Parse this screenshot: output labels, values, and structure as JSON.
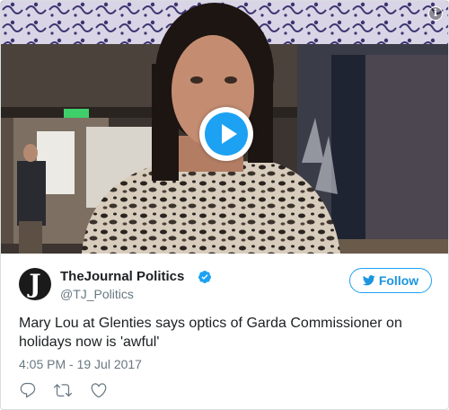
{
  "tweet": {
    "media": {
      "type": "video",
      "play_icon": "play-icon",
      "info_icon": "info-icon",
      "info_glyph": "i"
    },
    "author": {
      "avatar_letter": "J",
      "display_name": "TheJournal Politics",
      "handle": "@TJ_Politics",
      "verified": true
    },
    "follow_label": "Follow",
    "text": "Mary Lou at Glenties says optics of Garda Commissioner on holidays now is 'awful'",
    "timestamp": "4:05 PM - 19 Jul 2017",
    "actions": [
      "reply-icon",
      "retweet-icon",
      "like-icon"
    ],
    "colors": {
      "accent": "#1da1f2",
      "link": "#1b95e0",
      "muted": "#697882",
      "text": "#1c2022"
    }
  }
}
